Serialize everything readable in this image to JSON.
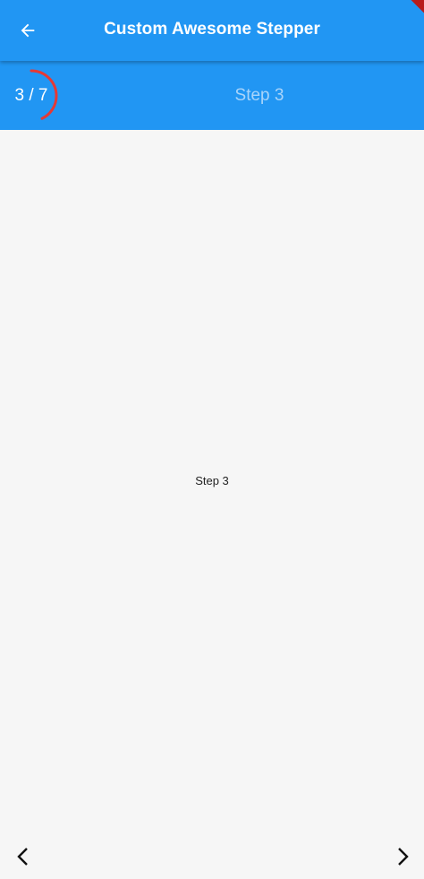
{
  "app_bar": {
    "title": "Custom Awesome Stepper",
    "back_icon": "arrow-back-icon"
  },
  "stepper": {
    "counter": "3 / 7",
    "current_step": 3,
    "total_steps": 7,
    "progress_fraction": 0.4286,
    "title": "Step 3",
    "ring_color": "#e53935"
  },
  "content": {
    "text": "Step 3"
  },
  "navigation": {
    "prev_icon": "chevron-left-icon",
    "next_icon": "chevron-right-icon"
  },
  "colors": {
    "primary": "#2196f3",
    "background": "#f6f6f6",
    "inactive_title": "#a9d4fa"
  }
}
